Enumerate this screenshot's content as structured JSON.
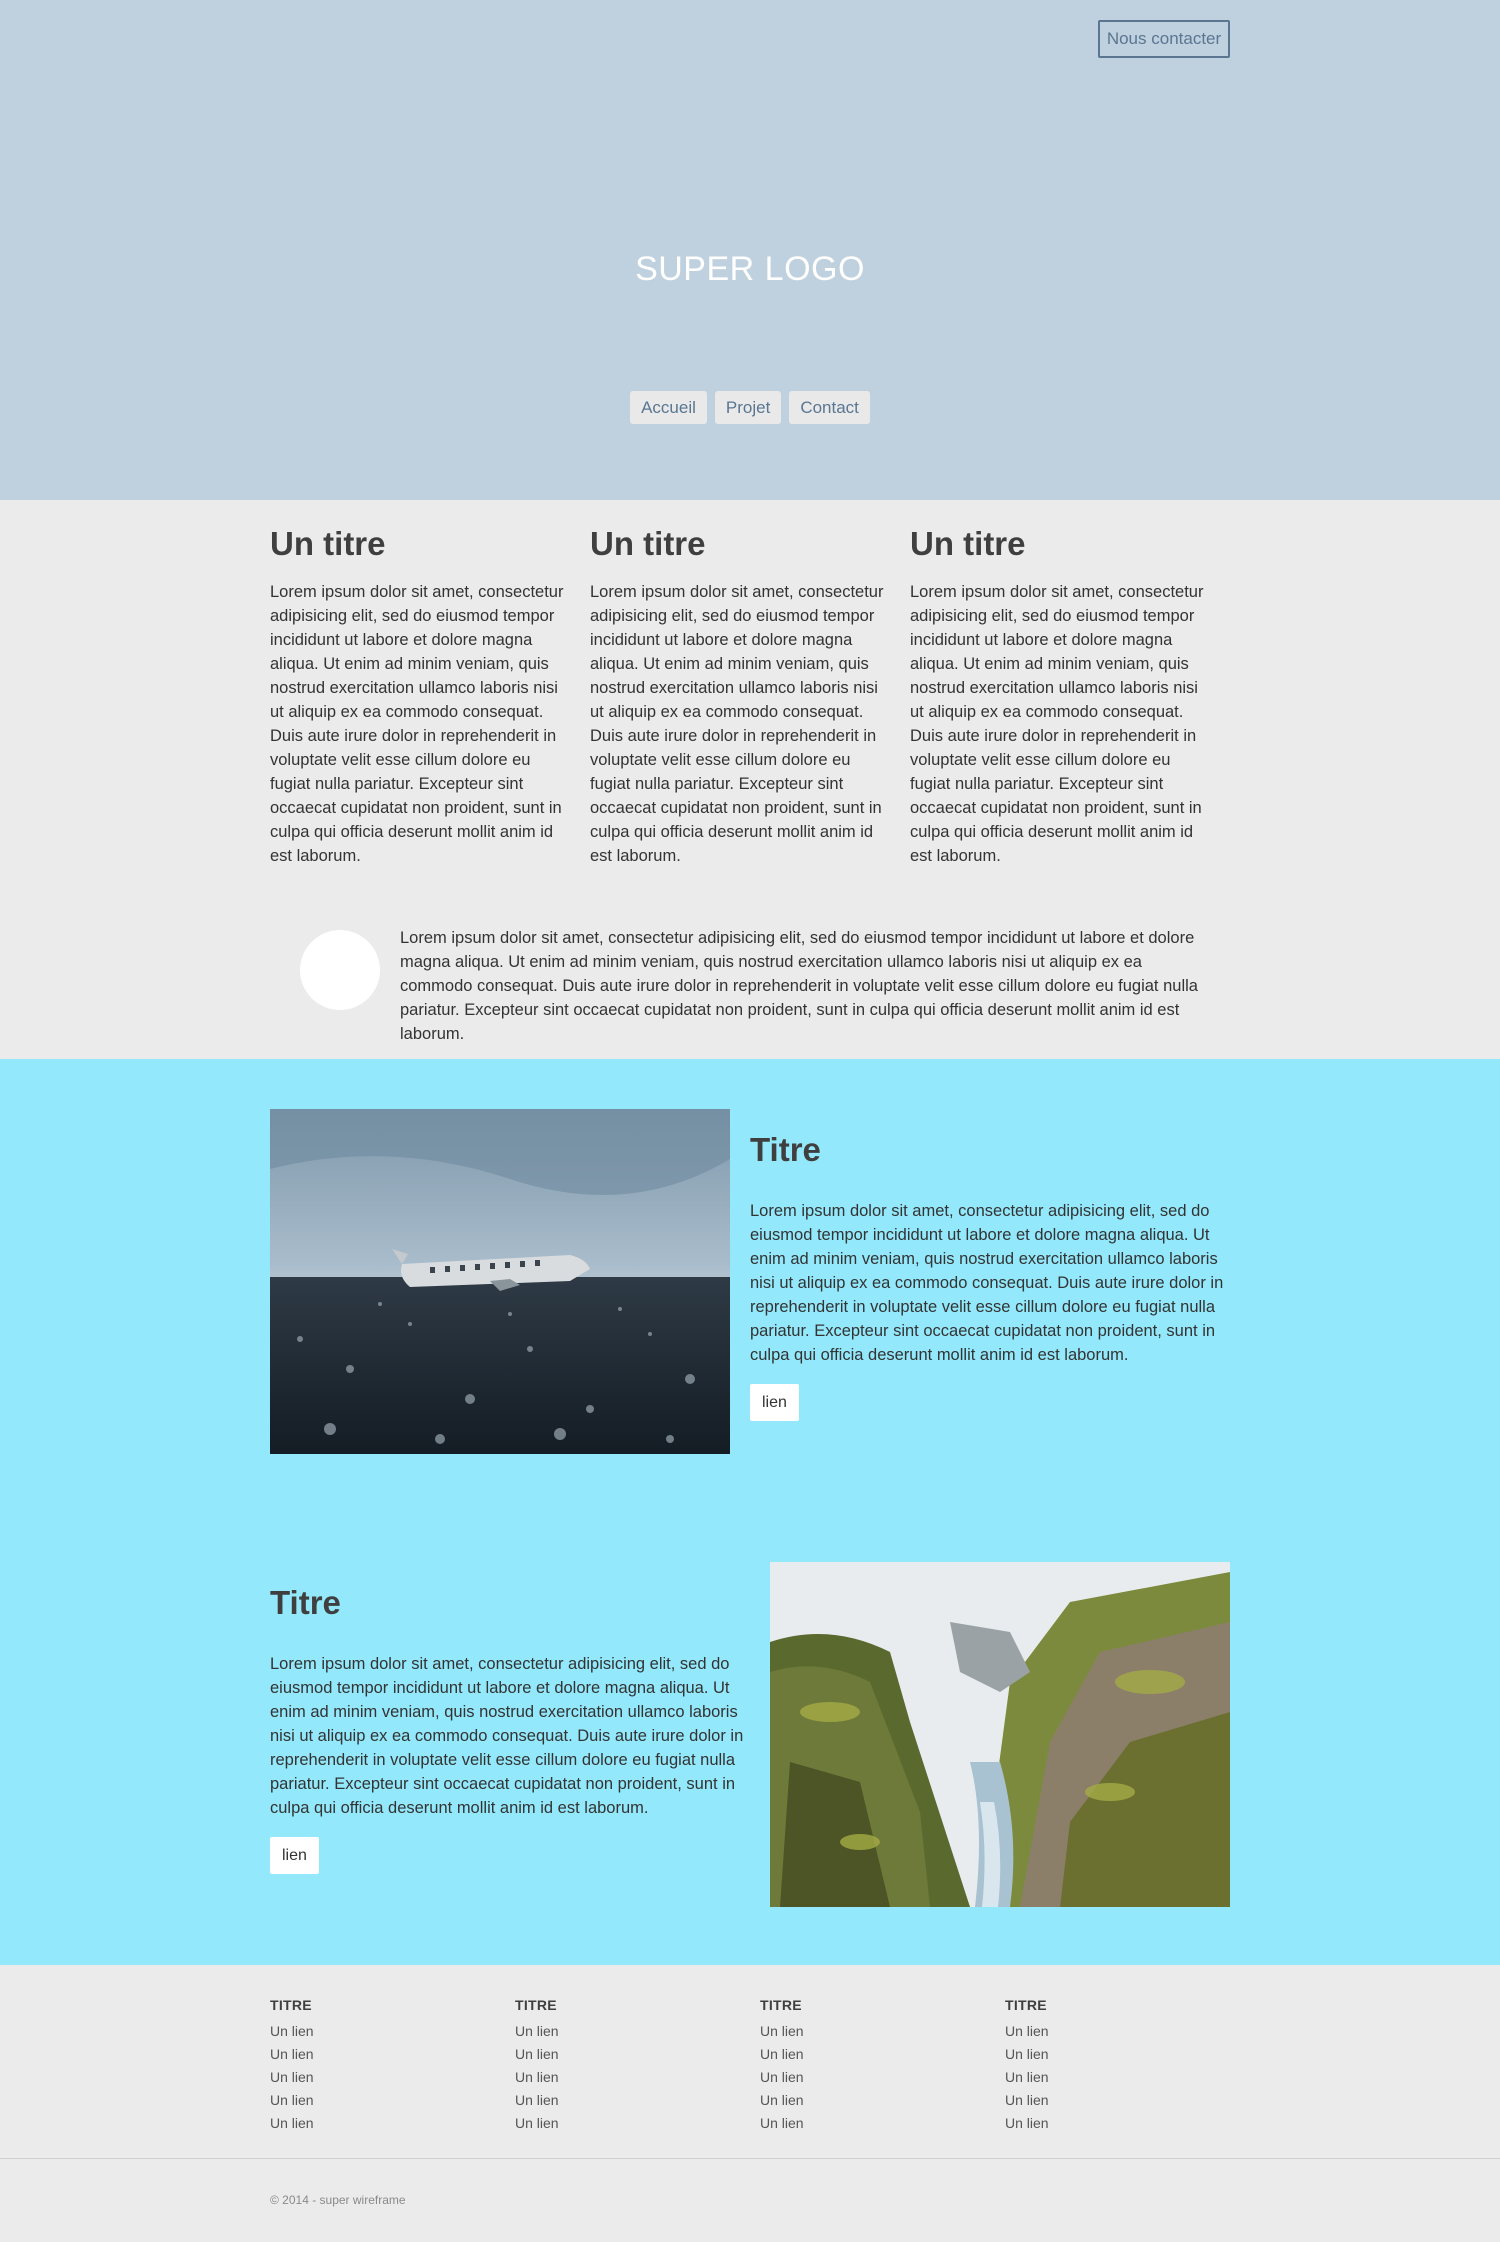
{
  "header": {
    "contact_label": "Nous contacter",
    "logo": "SUPER LOGO",
    "nav": [
      "Accueil",
      "Projet",
      "Contact"
    ]
  },
  "columns": [
    {
      "title": "Un titre",
      "text": "Lorem ipsum dolor sit amet, consectetur adipisicing elit, sed do eiusmod tempor incididunt ut labore et dolore magna aliqua. Ut enim ad minim veniam, quis nostrud exercitation ullamco laboris nisi ut aliquip ex ea commodo consequat. Duis aute irure dolor in reprehenderit in voluptate velit esse cillum dolore eu fugiat nulla pariatur. Excepteur sint occaecat cupidatat non proident, sunt in culpa qui officia deserunt mollit anim id est laborum."
    },
    {
      "title": "Un titre",
      "text": "Lorem ipsum dolor sit amet, consectetur adipisicing elit, sed do eiusmod tempor incididunt ut labore et dolore magna aliqua. Ut enim ad minim veniam, quis nostrud exercitation ullamco laboris nisi ut aliquip ex ea commodo consequat. Duis aute irure dolor in reprehenderit in voluptate velit esse cillum dolore eu fugiat nulla pariatur. Excepteur sint occaecat cupidatat non proident, sunt in culpa qui officia deserunt mollit anim id est laborum."
    },
    {
      "title": "Un titre",
      "text": "Lorem ipsum dolor sit amet, consectetur adipisicing elit, sed do eiusmod tempor incididunt ut labore et dolore magna aliqua. Ut enim ad minim veniam, quis nostrud exercitation ullamco laboris nisi ut aliquip ex ea commodo consequat. Duis aute irure dolor in reprehenderit in voluptate velit esse cillum dolore eu fugiat nulla pariatur. Excepteur sint occaecat cupidatat non proident, sunt in culpa qui officia deserunt mollit anim id est laborum."
    }
  ],
  "testimonial": {
    "text": "Lorem ipsum dolor sit amet, consectetur adipisicing elit, sed do eiusmod tempor incididunt ut labore et dolore magna aliqua. Ut enim ad minim veniam, quis nostrud exercitation ullamco laboris nisi ut aliquip ex ea commodo consequat. Duis aute irure dolor in reprehenderit in voluptate velit esse cillum dolore eu fugiat nulla pariatur. Excepteur sint occaecat cupidatat non proident, sunt in culpa qui officia deserunt mollit anim id est laborum."
  },
  "features": [
    {
      "title": "Titre",
      "text": "Lorem ipsum dolor sit amet, consectetur adipisicing elit, sed do eiusmod tempor incididunt ut labore et dolore magna aliqua. Ut enim ad minim veniam, quis nostrud exercitation ullamco laboris nisi ut aliquip ex ea commodo consequat. Duis aute irure dolor in reprehenderit in voluptate velit esse cillum dolore eu fugiat nulla pariatur. Excepteur sint occaecat cupidatat non proident, sunt in culpa qui officia deserunt mollit anim id est laborum.",
      "link": "lien",
      "image": "plane-wreck-photo"
    },
    {
      "title": "Titre",
      "text": "Lorem ipsum dolor sit amet, consectetur adipisicing elit, sed do eiusmod tempor incididunt ut labore et dolore magna aliqua. Ut enim ad minim veniam, quis nostrud exercitation ullamco laboris nisi ut aliquip ex ea commodo consequat. Duis aute irure dolor in reprehenderit in voluptate velit esse cillum dolore eu fugiat nulla pariatur. Excepteur sint occaecat cupidatat non proident, sunt in culpa qui officia deserunt mollit anim id est laborum.",
      "link": "lien",
      "image": "canyon-photo"
    }
  ],
  "footer": {
    "columns": [
      {
        "title": "TITRE",
        "links": [
          "Un lien",
          "Un lien",
          "Un lien",
          "Un lien",
          "Un lien"
        ]
      },
      {
        "title": "TITRE",
        "links": [
          "Un lien",
          "Un lien",
          "Un lien",
          "Un lien",
          "Un lien"
        ]
      },
      {
        "title": "TITRE",
        "links": [
          "Un lien",
          "Un lien",
          "Un lien",
          "Un lien",
          "Un lien"
        ]
      },
      {
        "title": "TITRE",
        "links": [
          "Un lien",
          "Un lien",
          "Un lien",
          "Un lien",
          "Un lien"
        ]
      }
    ],
    "copyright": "© 2014 - super wireframe"
  },
  "colors": {
    "hero_bg": "#bfd1df",
    "accent": "#5a7691",
    "cyan_bg": "#93e9fb",
    "page_bg": "#ebebeb"
  }
}
